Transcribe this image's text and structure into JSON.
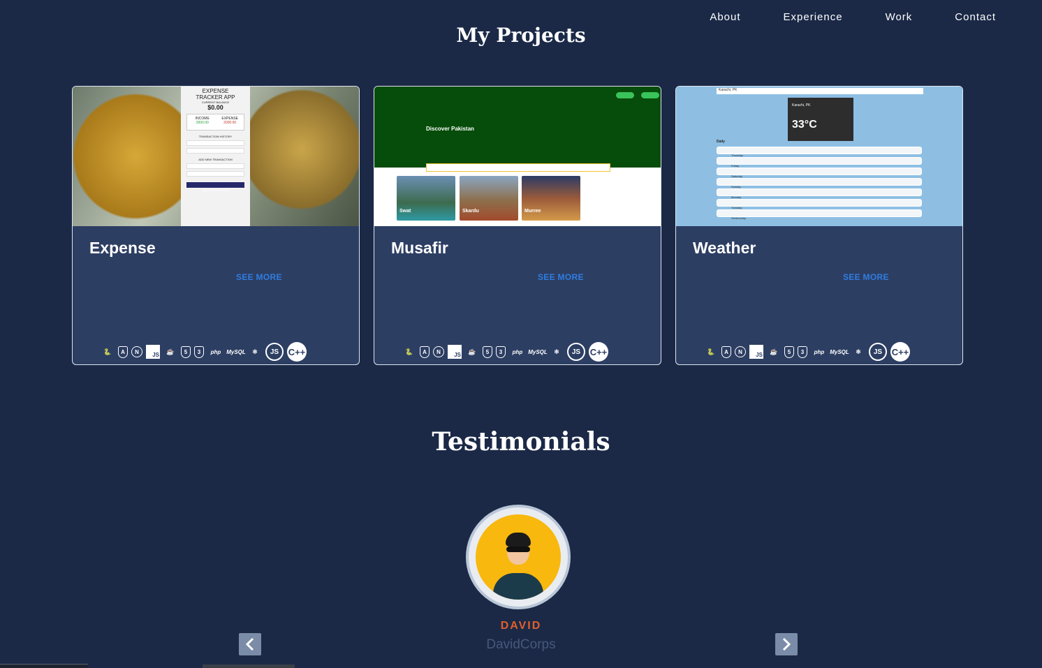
{
  "nav": {
    "items": [
      "About",
      "Experience",
      "Work",
      "Contact"
    ]
  },
  "projects": {
    "title": "My Projects",
    "see_more_label": "SEE MORE",
    "cards": [
      {
        "title": "Expense",
        "thumb": {
          "app_title_1": "EXPENSE",
          "app_title_2": "TRACKER APP",
          "balance_label": "CURRENT BALANCE",
          "balance": "$0.00",
          "income_label": "INCOME",
          "income": "2000.00",
          "expense_label": "EXPENSE",
          "expense": "2000.00",
          "history_label": "TRANSACTION HISTORY",
          "add_label": "ADD NEW TRANSACTION",
          "button_label": "ADD TRANSACTION"
        }
      },
      {
        "title": "Musafir",
        "thumb": {
          "headline": "Discover Pakistan",
          "places": [
            "Swat",
            "Skardu",
            "Murree"
          ]
        }
      },
      {
        "title": "Weather",
        "thumb": {
          "city": "Karachi, PK",
          "temperature": "33°C",
          "daily_label": "Daily",
          "days": [
            "Thursday",
            "Friday",
            "Saturday",
            "Sunday",
            "Monday",
            "Tuesday",
            "Wednesday"
          ]
        }
      }
    ],
    "tech_icons": [
      "python-icon",
      "angular-icon",
      "nextjs-icon",
      "js-icon",
      "java-icon",
      "html5-icon",
      "css3-icon",
      "php-icon",
      "mysql-icon",
      "react-icon",
      "nodejs-icon",
      "cpp-icon"
    ],
    "tech_glyphs": [
      "🐍",
      "A",
      "N",
      "JS",
      "☕",
      "5",
      "3",
      "php",
      "MySQL",
      "⚛",
      "JS",
      "C++"
    ]
  },
  "testimonials": {
    "title": "Testimonials",
    "name": "DAVID",
    "company": "DavidCorps"
  },
  "colors": {
    "background": "#1b2947",
    "card": "#2d3e63",
    "accent_link": "#2f7de1",
    "name_accent": "#e0602b"
  }
}
